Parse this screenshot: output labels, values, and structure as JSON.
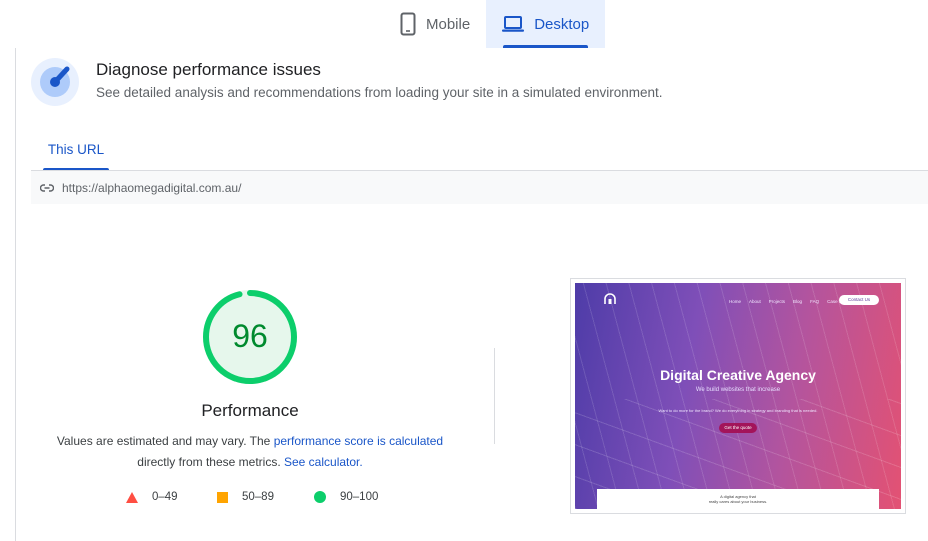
{
  "device_tabs": [
    {
      "label": "Mobile",
      "active": false,
      "icon": "smartphone-icon"
    },
    {
      "label": "Desktop",
      "active": true,
      "icon": "laptop-icon"
    }
  ],
  "diagnose": {
    "icon": "speedometer-icon",
    "title": "Diagnose performance issues",
    "subtitle": "See detailed analysis and recommendations from loading your site in a simulated environment."
  },
  "url_tab": {
    "label": "This URL"
  },
  "url_bar": {
    "icon": "link-icon",
    "url": "https://alphaomegadigital.com.au/"
  },
  "score": {
    "value": "96",
    "fraction": 0.96,
    "label": "Performance",
    "color": "#0cce6b",
    "text_color": "#008a2e"
  },
  "estimate": {
    "prefix": "Values are estimated and may vary. The",
    "link1": "performance score is calculated",
    "middle": "directly from these metrics.",
    "link2": "See calculator."
  },
  "legend": [
    {
      "range": "0–49",
      "shape": "triangle-icon",
      "color": "#ff4e42"
    },
    {
      "range": "50–89",
      "shape": "square-icon",
      "color": "#ffa400"
    },
    {
      "range": "90–100",
      "shape": "circle-icon",
      "color": "#0cce6b"
    }
  ],
  "screenshot": {
    "nav": [
      "Home",
      "About",
      "Projects",
      "Blog",
      "FAQ",
      "Case Study"
    ],
    "contact": "Contact Us",
    "headline": "Digital Creative Agency",
    "tagline": "We build websites that increase",
    "small": "Want to do more for the brand? We do everything in strategy and branding that is needed.",
    "cta": "Get the quote",
    "panel_line1": "A digital agency that",
    "panel_line2": "really cares about your business."
  }
}
